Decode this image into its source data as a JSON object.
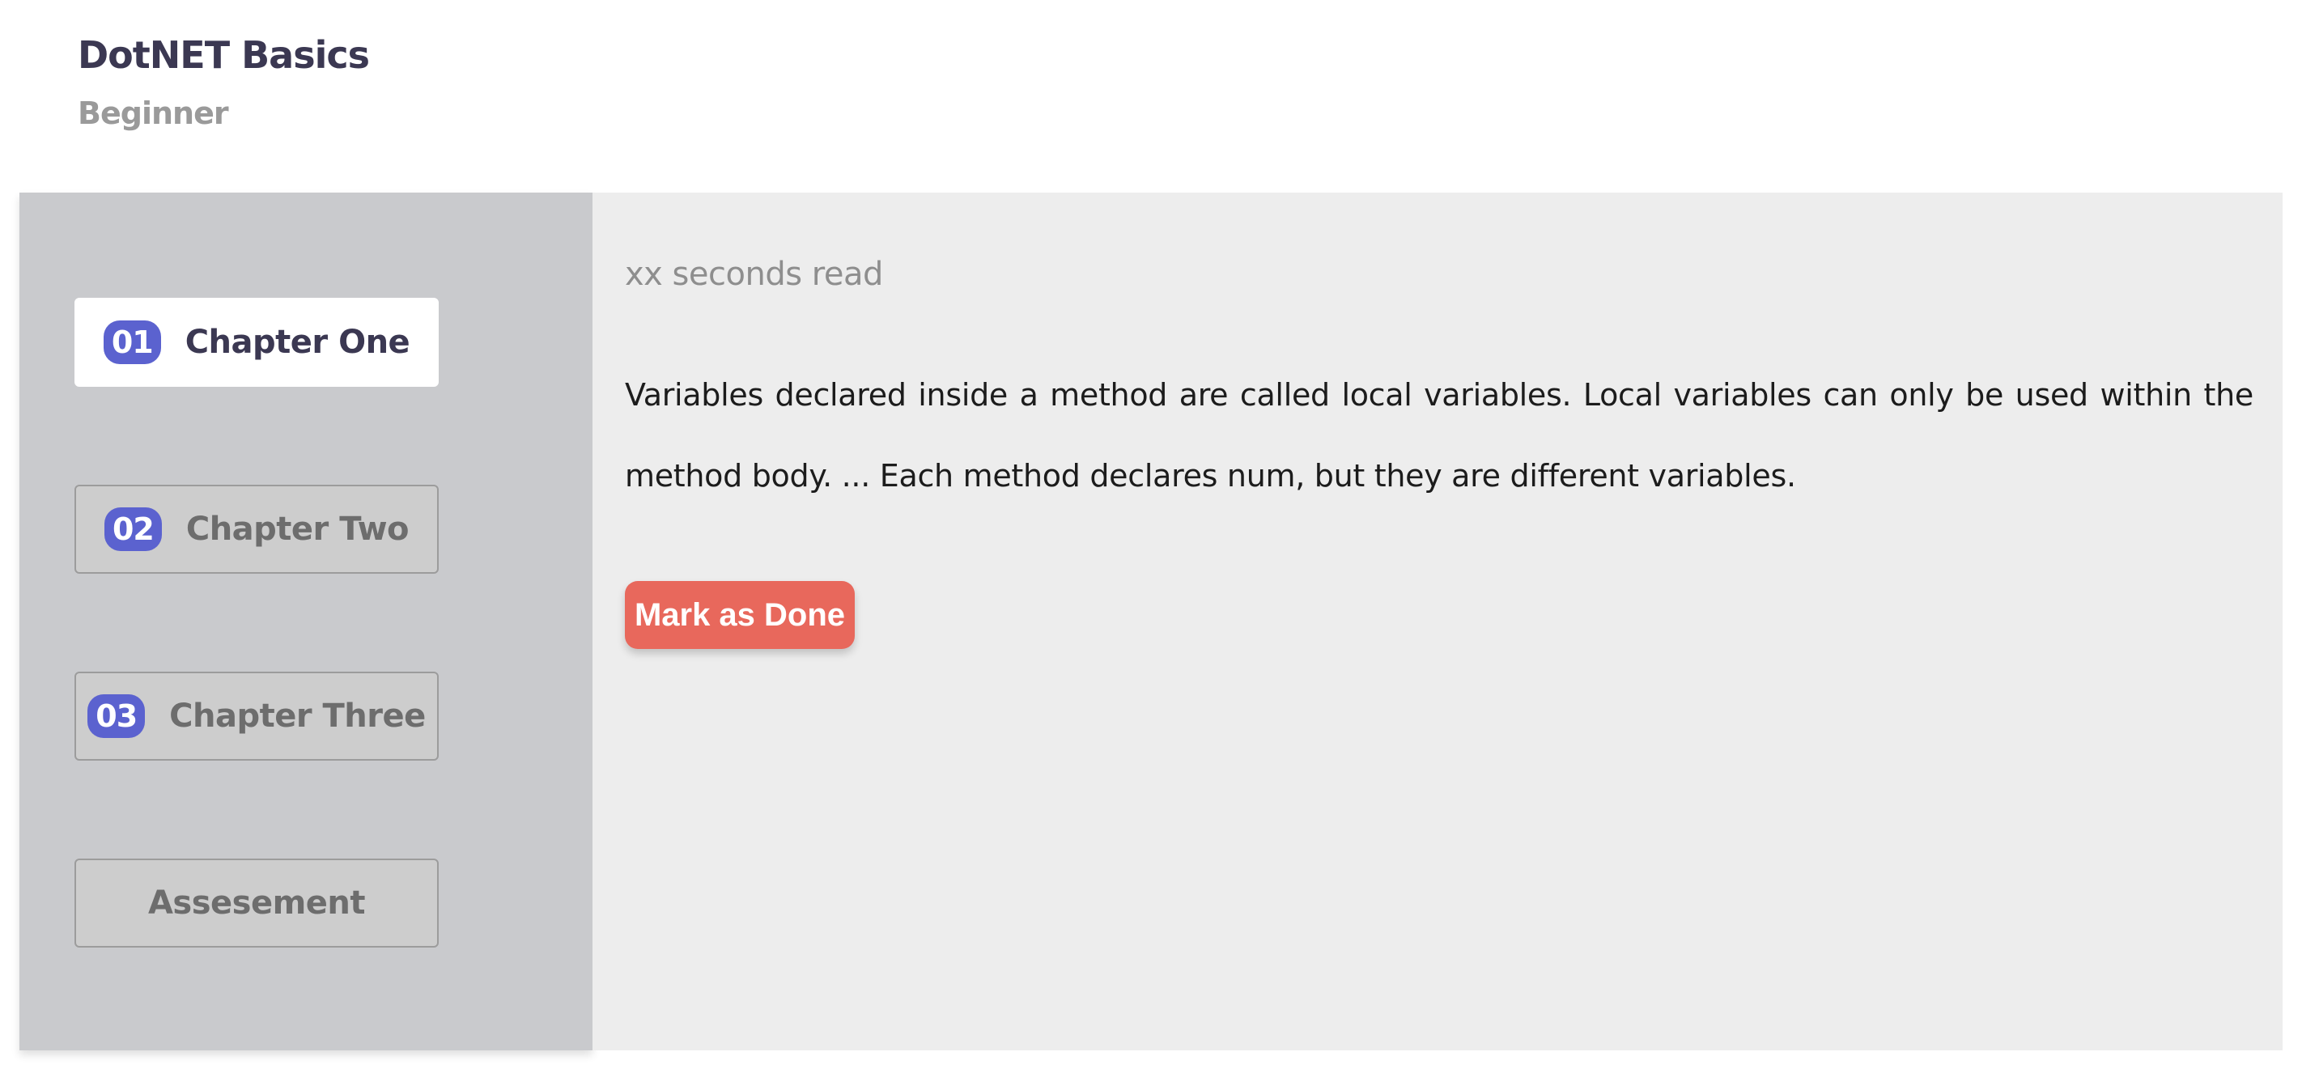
{
  "course": {
    "title": "DotNET Basics",
    "level": "Beginner"
  },
  "sidebar": {
    "items": [
      {
        "number": "01",
        "label": "Chapter One",
        "active": true
      },
      {
        "number": "02",
        "label": "Chapter Two",
        "active": false
      },
      {
        "number": "03",
        "label": "Chapter Three",
        "active": false
      }
    ],
    "assessment_label": "Assesement"
  },
  "content": {
    "read_time": "xx seconds read",
    "body": "Variables declared inside a method are called local variables. Local variables can only be used within the method body. ... Each method declares num, but they are different variables.",
    "done_label": "Mark as Done"
  },
  "colors": {
    "accent": "#5b62cf",
    "button": "#e8685c",
    "sidebar_bg": "#c9cacd",
    "content_bg": "#ededed",
    "title": "#3b3852"
  }
}
